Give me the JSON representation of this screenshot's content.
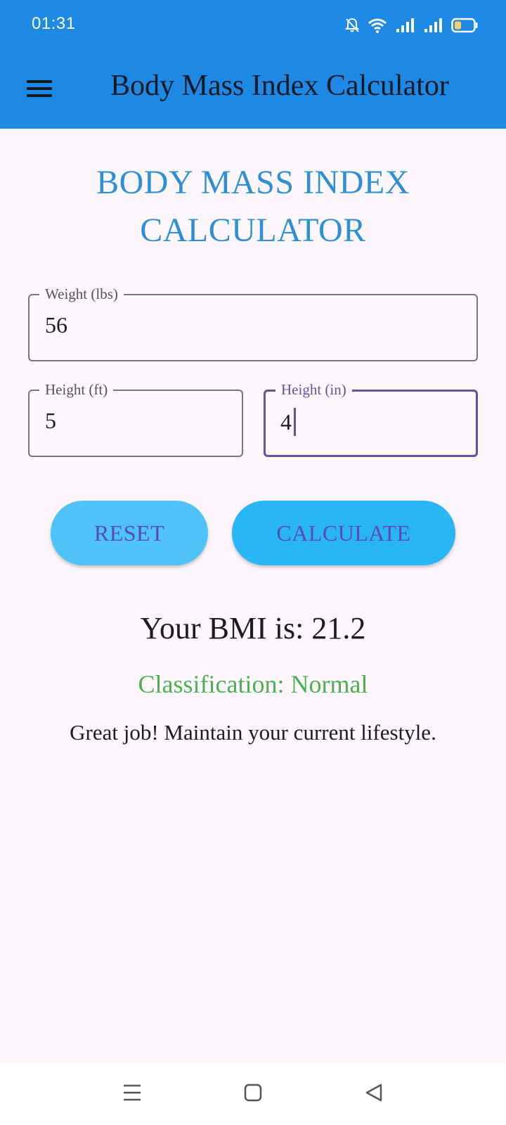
{
  "status_bar": {
    "time": "01:31",
    "icons": [
      "bell-muted-icon",
      "wifi-icon",
      "signal-icon",
      "signal-icon",
      "battery-icon"
    ]
  },
  "app_bar": {
    "title": "Body Mass Index Calculator",
    "menu_icon": "menu-icon"
  },
  "main": {
    "heading_line1": "BODY MASS INDEX",
    "heading_line2": "CALCULATOR",
    "weight": {
      "label": "Weight (lbs)",
      "value": "56"
    },
    "height_ft": {
      "label": "Height (ft)",
      "value": "5"
    },
    "height_in": {
      "label": "Height (in)",
      "value": "4"
    },
    "reset_label": "RESET",
    "calculate_label": "CALCULATE",
    "bmi_text": "Your BMI is: 21.2",
    "classification_text": "Classification: Normal",
    "advice_text": "Great job! Maintain your current lifestyle."
  },
  "colors": {
    "app_bar": "#1e88e5",
    "heading": "#2d8fd6",
    "reset_button": "#4fc3f7",
    "calculate_button": "#29b6f6",
    "classification": "#4caf50",
    "focus": "#6750a4"
  },
  "nav_bar": {
    "icons": [
      "recents-icon",
      "home-icon",
      "back-icon"
    ]
  }
}
